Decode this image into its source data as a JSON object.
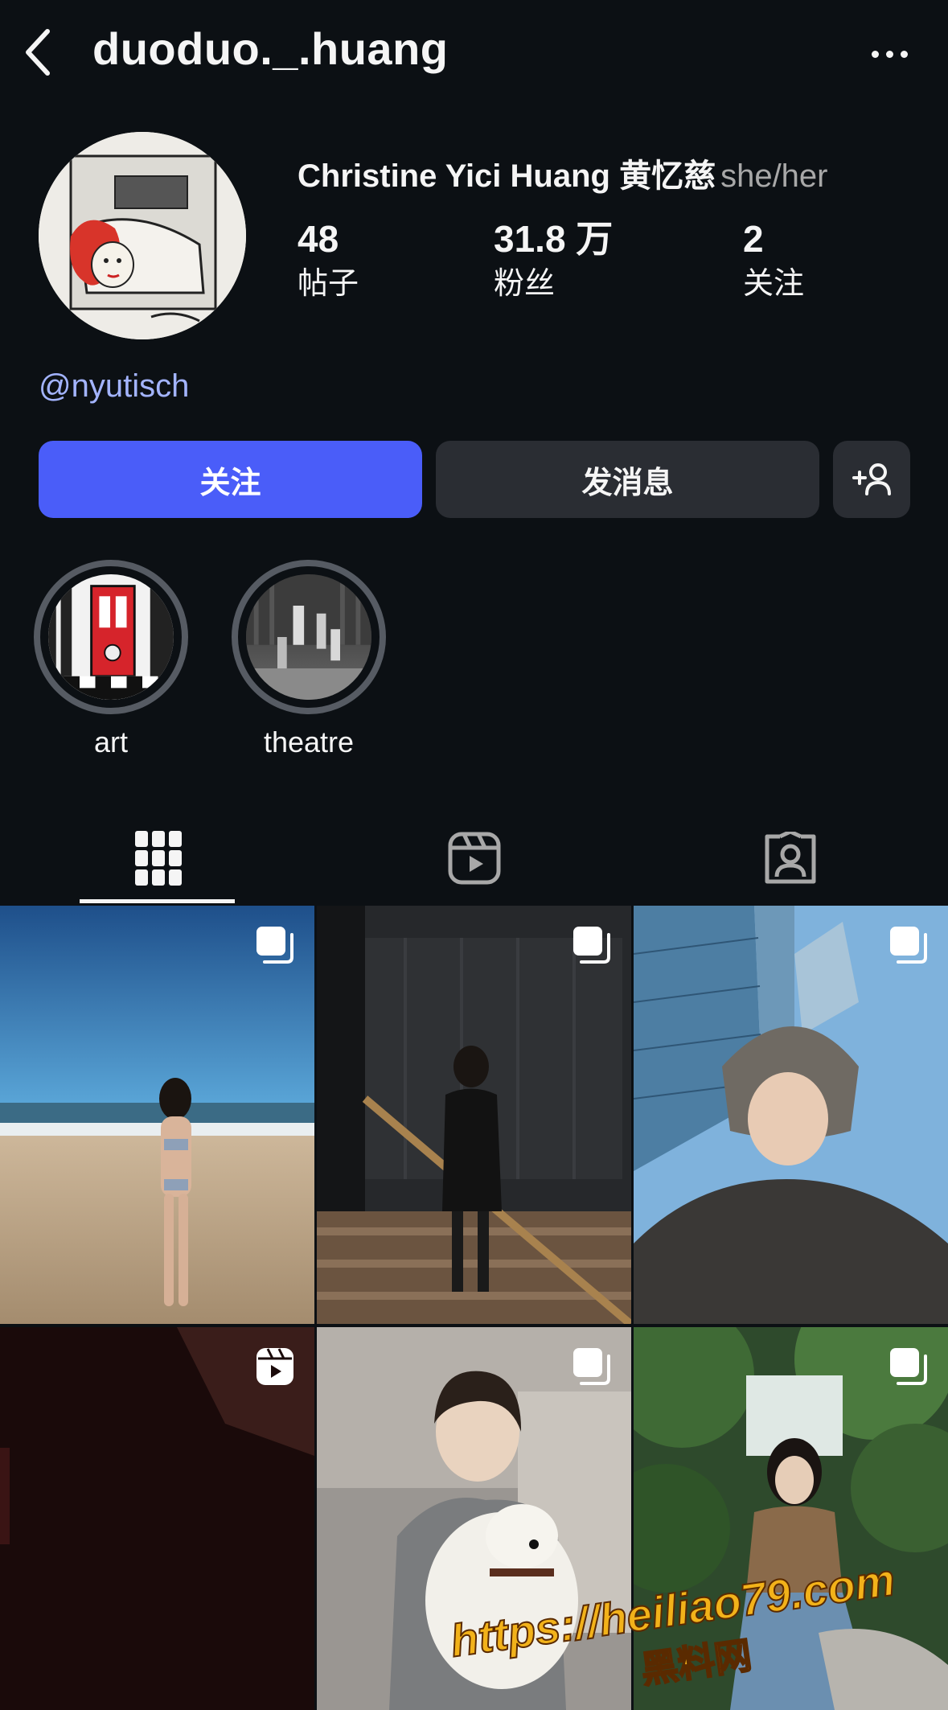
{
  "header": {
    "username": "duoduo._.huang"
  },
  "profile": {
    "full_name": "Christine Yici Huang 黄忆慈",
    "pronouns": "she/her",
    "stats": [
      {
        "value": "48",
        "label": "帖子"
      },
      {
        "value": "31.8 万",
        "label": "粉丝"
      },
      {
        "value": "2",
        "label": "关注"
      }
    ],
    "bio_link": "@nyutisch"
  },
  "actions": {
    "follow_label": "关注",
    "message_label": "发消息"
  },
  "highlights": [
    {
      "label": "art"
    },
    {
      "label": "theatre"
    }
  ],
  "tabs": [
    "posts-grid",
    "reels",
    "tagged"
  ],
  "watermark": {
    "url": "https://heiliao79.com",
    "name": "黑料网"
  },
  "colors": {
    "background": "#0c1014",
    "follow_button": "#4a5df9",
    "secondary_button": "#2a2d33",
    "link": "#a3b4ff"
  }
}
